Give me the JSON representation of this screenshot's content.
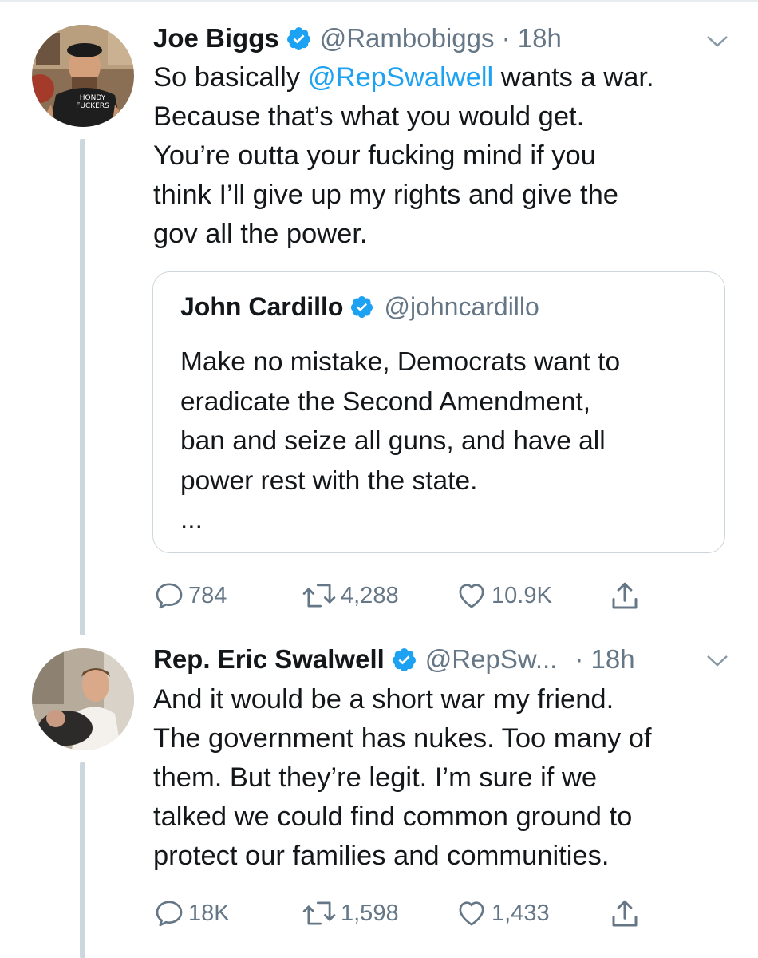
{
  "tweets": [
    {
      "name": "Joe Biggs",
      "handle": "@Rambobiggs · 18h",
      "text_lines": [
        [
          "So basically ",
          "@RepSwalwell",
          " wants a war."
        ],
        [
          "Because that’s what you would get."
        ],
        [
          "You’re outta your fucking mind if you"
        ],
        [
          "think I’ll give up my rights and give the"
        ],
        [
          "gov all the power."
        ]
      ],
      "avatar_shirt_text": [
        "HONDY",
        "FUCKERS"
      ],
      "quote": {
        "name": "John Cardillo",
        "handle": "@johncardillo",
        "lines": [
          "Make no mistake, Democrats want to",
          "eradicate the Second Amendment,",
          "ban and seize all guns, and have all",
          "power rest with the state.",
          "..."
        ]
      },
      "actions": {
        "replies": "784",
        "retweets": "4,288",
        "likes": "10.9K"
      }
    },
    {
      "name": "Rep. Eric Swalwell",
      "handle": "@RepSw...",
      "time": "· 18h",
      "text_lines": [
        "And it would be a short war my friend.",
        "The government has nukes. Too many of",
        "them. But they’re legit. I’m sure if we",
        "talked we could find common ground to",
        "protect our families and communities."
      ],
      "actions": {
        "replies": "18K",
        "retweets": "1,598",
        "likes": "1,433"
      }
    }
  ],
  "colors": {
    "link": "#1da1f2",
    "secondary": "#657786",
    "verified": "#1da1f2",
    "thread_line": "#ccd6dd"
  },
  "icons": [
    "verified-badge-icon",
    "chevron-down-icon",
    "reply-icon",
    "retweet-icon",
    "like-icon",
    "share-icon"
  ]
}
